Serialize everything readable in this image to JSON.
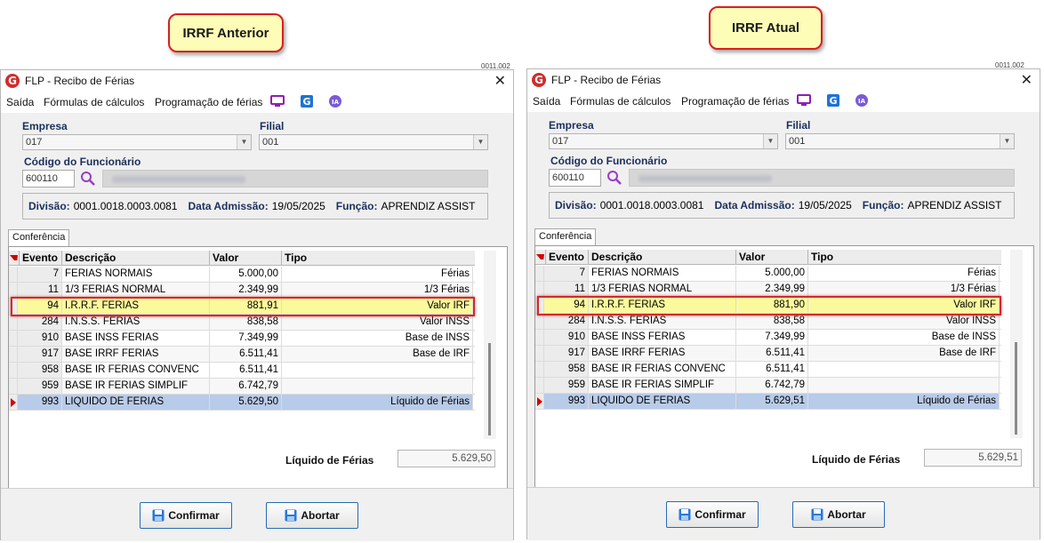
{
  "callouts": {
    "left": "IRRF Anterior",
    "right": "IRRF Atual"
  },
  "corner_text": "0011.002",
  "windows": [
    {
      "title": "FLP - Recibo de Férias",
      "menu": [
        "Saída",
        "Fórmulas de cálculos",
        "Programação de férias"
      ],
      "empresa_label": "Empresa",
      "empresa_value": "017",
      "filial_label": "Filial",
      "filial_value": "001",
      "funcionario_label": "Código do Funcionário",
      "funcionario_code": "600110",
      "divisao_label": "Divisão:",
      "divisao_value": "0001.0018.0003.0081",
      "admissao_label": "Data Admissão:",
      "admissao_value": "19/05/2025",
      "funcao_label": "Função:",
      "funcao_value": "APRENDIZ ASSIST",
      "tab_label": "Conferência",
      "columns": [
        "Evento",
        "Descrição",
        "Valor",
        "Tipo"
      ],
      "rows": [
        {
          "ev": "7",
          "desc": "FERIAS NORMAIS",
          "val": "5.000,00",
          "tipo": "Férias"
        },
        {
          "ev": "11",
          "desc": "1/3 FERIAS NORMAL",
          "val": "2.349,99",
          "tipo": "1/3 Férias"
        },
        {
          "ev": "94",
          "desc": "I.R.R.F. FERIAS",
          "val": "881,91",
          "tipo": "Valor IRF"
        },
        {
          "ev": "284",
          "desc": "I.N.S.S. FERIAS",
          "val": "838,58",
          "tipo": "Valor INSS"
        },
        {
          "ev": "910",
          "desc": "BASE INSS FERIAS",
          "val": "7.349,99",
          "tipo": "Base de INSS"
        },
        {
          "ev": "917",
          "desc": "BASE IRRF FERIAS",
          "val": "6.511,41",
          "tipo": "Base de IRF"
        },
        {
          "ev": "958",
          "desc": "BASE IR FERIAS CONVENC",
          "val": "6.511,41",
          "tipo": ""
        },
        {
          "ev": "959",
          "desc": "BASE IR FERIAS SIMPLIF",
          "val": "6.742,79",
          "tipo": ""
        },
        {
          "ev": "993",
          "desc": "LIQUIDO DE FERIAS",
          "val": "5.629,50",
          "tipo": "Líquido de Férias"
        }
      ],
      "total_label": "Líquido de Férias",
      "total_value": "5.629,50",
      "confirm_label": "Confirmar",
      "abort_label": "Abortar"
    },
    {
      "title": "FLP - Recibo de Férias",
      "menu": [
        "Saída",
        "Fórmulas de cálculos",
        "Programação de férias"
      ],
      "empresa_label": "Empresa",
      "empresa_value": "017",
      "filial_label": "Filial",
      "filial_value": "001",
      "funcionario_label": "Código do Funcionário",
      "funcionario_code": "600110",
      "divisao_label": "Divisão:",
      "divisao_value": "0001.0018.0003.0081",
      "admissao_label": "Data Admissão:",
      "admissao_value": "19/05/2025",
      "funcao_label": "Função:",
      "funcao_value": "APRENDIZ ASSIST",
      "tab_label": "Conferência",
      "columns": [
        "Evento",
        "Descrição",
        "Valor",
        "Tipo"
      ],
      "rows": [
        {
          "ev": "7",
          "desc": "FERIAS NORMAIS",
          "val": "5.000,00",
          "tipo": "Férias"
        },
        {
          "ev": "11",
          "desc": "1/3 FERIAS NORMAL",
          "val": "2.349,99",
          "tipo": "1/3 Férias"
        },
        {
          "ev": "94",
          "desc": "I.R.R.F. FERIAS",
          "val": "881,90",
          "tipo": "Valor IRF"
        },
        {
          "ev": "284",
          "desc": "I.N.S.S. FERIAS",
          "val": "838,58",
          "tipo": "Valor INSS"
        },
        {
          "ev": "910",
          "desc": "BASE INSS FERIAS",
          "val": "7.349,99",
          "tipo": "Base de INSS"
        },
        {
          "ev": "917",
          "desc": "BASE IRRF FERIAS",
          "val": "6.511,41",
          "tipo": "Base de IRF"
        },
        {
          "ev": "958",
          "desc": "BASE IR FERIAS CONVENC",
          "val": "6.511,41",
          "tipo": ""
        },
        {
          "ev": "959",
          "desc": "BASE IR FERIAS SIMPLIF",
          "val": "6.742,79",
          "tipo": ""
        },
        {
          "ev": "993",
          "desc": "LIQUIDO DE FERIAS",
          "val": "5.629,51",
          "tipo": "Líquido de Férias"
        }
      ],
      "total_label": "Líquido de Férias",
      "total_value": "5.629,51",
      "confirm_label": "Confirmar",
      "abort_label": "Abortar"
    }
  ],
  "icons": [
    "monitor-icon",
    "g-app-icon",
    "ia-icon",
    "search-icon",
    "save-disk-icon",
    "close-icon"
  ],
  "colors": {
    "highlight_row": "#fafa9c",
    "selected_row": "#b8cbe9",
    "annotation_red": "#d22a2a",
    "label_blue": "#1b2f5c"
  }
}
